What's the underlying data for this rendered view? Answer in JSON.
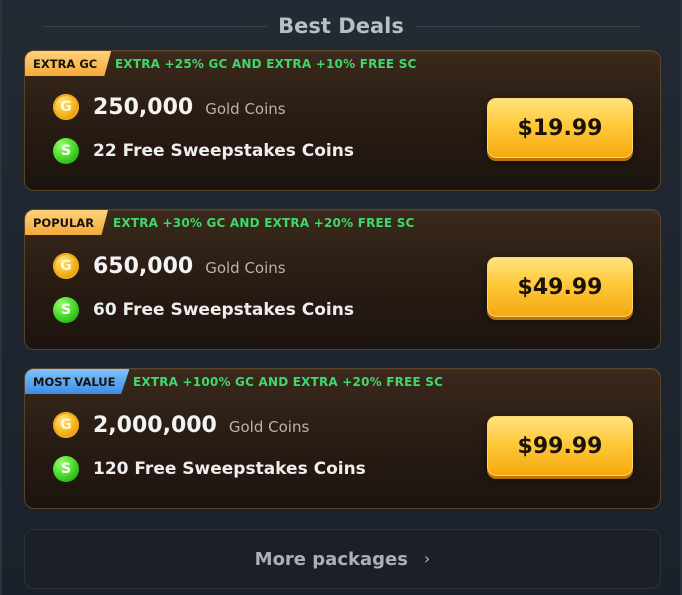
{
  "header": {
    "title": "Best Deals"
  },
  "deals": [
    {
      "badge": "EXTRA GC",
      "extra": "EXTRA +25% GC AND EXTRA +10% FREE SC",
      "gc_amount": "250,000",
      "gc_label": "Gold Coins",
      "sc_text": "22 Free Sweepstakes Coins",
      "price": "$19.99"
    },
    {
      "badge": "POPULAR",
      "extra": "EXTRA +30% GC AND EXTRA +20% FREE SC",
      "gc_amount": "650,000",
      "gc_label": "Gold Coins",
      "sc_text": "60 Free Sweepstakes Coins",
      "price": "$49.99"
    },
    {
      "badge": "MOST VALUE",
      "extra": "EXTRA +100% GC AND EXTRA +20% FREE SC",
      "gc_amount": "2,000,000",
      "gc_label": "Gold Coins",
      "sc_text": "120 Free Sweepstakes Coins",
      "price": "$99.99"
    }
  ],
  "coins": {
    "gold_letter": "G",
    "sweeps_letter": "S"
  },
  "footer": {
    "more_label": "More packages",
    "chevron": "›"
  },
  "colors": {
    "extra_text": "#3fd86b",
    "badge_gold": "#f3a93a",
    "badge_blue": "#3b8ee6",
    "price_button": "#ffc93a"
  }
}
